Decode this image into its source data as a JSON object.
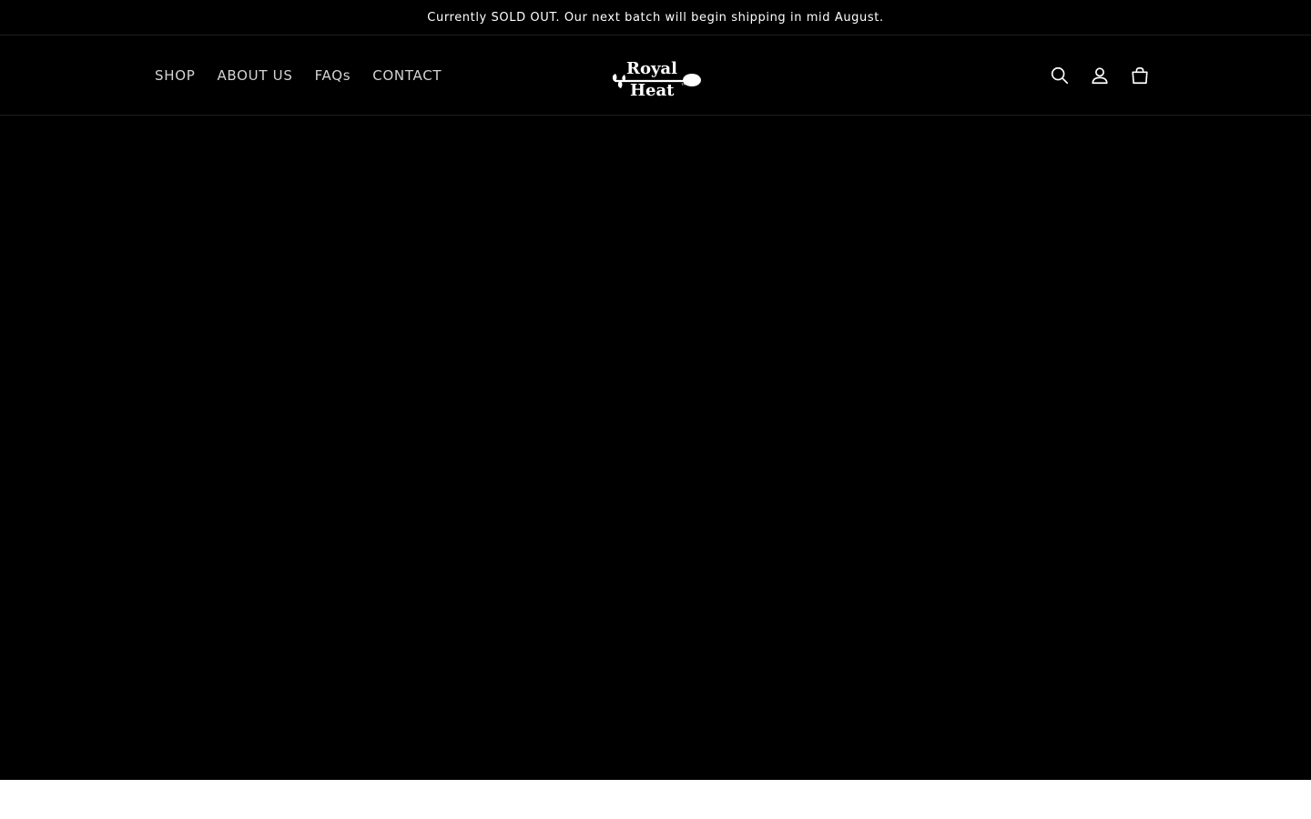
{
  "announcement": {
    "text": "Currently SOLD OUT. Our next batch will begin shipping in mid August."
  },
  "nav": {
    "items": [
      {
        "label": "SHOP"
      },
      {
        "label": "ABOUT US"
      },
      {
        "label": "FAQs"
      },
      {
        "label": "CONTACT"
      }
    ]
  },
  "logo": {
    "line1": "Royal",
    "line2": "Heat",
    "trademark": "™"
  },
  "header_icons": [
    "search-icon",
    "account-icon",
    "cart-icon"
  ],
  "colors": {
    "background": "#000000",
    "text": "#ffffff",
    "nav_text": "#d4d4d4",
    "page_below": "#ffffff"
  }
}
